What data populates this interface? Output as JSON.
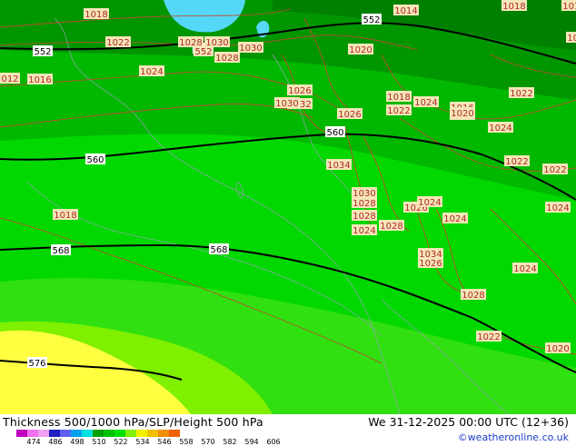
{
  "footer": {
    "title": "Thickness 500/1000 hPa/SLP/Height 500 hPa",
    "datetime": "We 31-12-2025 00:00 UTC (12+36)",
    "credit": "©weatheronline.co.uk",
    "colorbar_ticks": [
      "474",
      "486",
      "498",
      "510",
      "522",
      "534",
      "546",
      "558",
      "570",
      "582",
      "594",
      "606"
    ],
    "colorbar_colors": [
      "#c000c0",
      "#f070f0",
      "#f0a0f0",
      "#2020c0",
      "#6060f0",
      "#00a0f0",
      "#00e0e0",
      "#00a000",
      "#00c000",
      "#00e000",
      "#80f000",
      "#f0f000",
      "#f0c000",
      "#f09000",
      "#f06000"
    ]
  },
  "map": {
    "height_labels": [
      {
        "text": "552",
        "color": "#000000"
      },
      {
        "text": "552",
        "color": "#000000"
      },
      {
        "text": "552",
        "color": "#000000"
      },
      {
        "text": "560",
        "color": "#000000"
      },
      {
        "text": "560",
        "color": "#000000"
      },
      {
        "text": "568",
        "color": "#000000"
      },
      {
        "text": "568",
        "color": "#000000"
      },
      {
        "text": "576",
        "color": "#000000"
      }
    ],
    "pressure_labels": [
      "1018",
      "1022",
      "1028",
      "1030",
      "552",
      "1028",
      "1030",
      "1020",
      "1014",
      "1016",
      "1016",
      "012",
      "1024",
      "1026",
      "1032",
      "1030",
      "1026",
      "1018",
      "1022",
      "1024",
      "1018",
      "1020",
      "1022",
      "1024",
      "1034",
      "1022",
      "1022",
      "1030",
      "1028",
      "1028",
      "1024",
      "1028",
      "1026",
      "1024",
      "1024",
      "1018",
      "1034",
      "1026",
      "1024",
      "1028",
      "1022",
      "1020",
      "1024",
      "1014",
      "1016",
      "1018"
    ]
  }
}
